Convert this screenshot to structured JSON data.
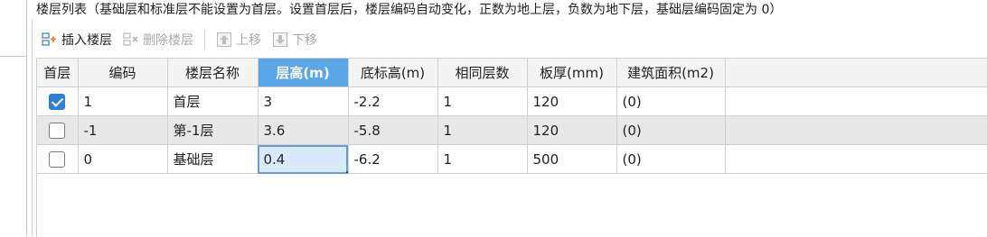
{
  "title": "楼层列表（基础层和标准层不能设置为首层。设置首层后，楼层编码自动变化，正数为地上层，负数为地下层，基础层编码固定为 0）",
  "toolbar": {
    "insert_label": "插入楼层",
    "delete_label": "删除楼层",
    "up_label": "上移",
    "down_label": "下移"
  },
  "columns": {
    "first_floor": "首层",
    "code": "编码",
    "name": "楼层名称",
    "height": "层高(m)",
    "bottom_elev": "底标高(m)",
    "same_count": "相同层数",
    "slab": "板厚(mm)",
    "area": "建筑面积(m2)"
  },
  "rows": [
    {
      "first": true,
      "code": "1",
      "name": "首层",
      "height": "3",
      "bottom": "-2.2",
      "same": "1",
      "slab": "120",
      "area": "(0)"
    },
    {
      "first": false,
      "code": "-1",
      "name": "第-1层",
      "height": "3.6",
      "bottom": "-5.8",
      "same": "1",
      "slab": "120",
      "area": "(0)"
    },
    {
      "first": false,
      "code": "0",
      "name": "基础层",
      "height": "0.4",
      "bottom": "-6.2",
      "same": "1",
      "slab": "500",
      "area": "(0)"
    }
  ],
  "colors": {
    "active_header": "#5ba6e6",
    "checkbox": "#2f7fd4",
    "editing_cell": "#d8eafc"
  },
  "icons": {
    "insert": "insert-floor-icon",
    "delete": "delete-floor-icon",
    "up": "arrow-up-icon",
    "down": "arrow-down-icon"
  }
}
